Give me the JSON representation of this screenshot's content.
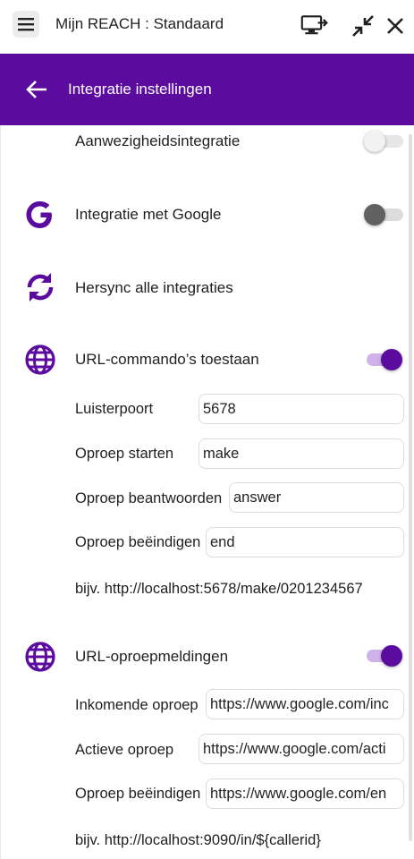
{
  "window": {
    "title": "Mijn REACH : Standaard",
    "icons": [
      "menu-icon",
      "screen-share-icon",
      "minimize-arrows-icon",
      "close-icon"
    ]
  },
  "header": {
    "title": "Integratie instellingen",
    "back_icon": "arrow-left-icon",
    "background": "#5b0c9e"
  },
  "settings": {
    "presence": {
      "label": "Aanwezigheidsintegratie",
      "enabled": false
    },
    "google": {
      "label": "Integratie met Google",
      "enabled": false,
      "icon": "google-g-icon"
    },
    "resync": {
      "label": "Hersync alle integraties",
      "icon": "sync-icon"
    },
    "url_commands": {
      "label": "URL-commando’s toestaan",
      "enabled": true,
      "icon": "globe-icon",
      "fields": {
        "port_label": "Luisterpoort",
        "port_value": "5678",
        "make_label": "Oproep starten",
        "make_value": "make",
        "answer_label": "Oproep beantwoorden",
        "answer_value": "answer",
        "end_label": "Oproep beëindigen",
        "end_value": "end"
      },
      "example": "bijv. http://localhost:5678/make/0201234567"
    },
    "url_notifications": {
      "label": "URL-oproepmeldingen",
      "enabled": true,
      "icon": "globe-icon",
      "fields": {
        "incoming_label": "Inkomende oproep",
        "incoming_value": "https://www.google.com/inc",
        "active_label": "Actieve oproep",
        "active_value": "https://www.google.com/acti",
        "end_label": "Oproep beëindigen",
        "end_value": "https://www.google.com/en"
      },
      "example": "bijv. http://localhost:9090/in/${callerid}"
    }
  },
  "colors": {
    "accent": "#5b0c9e",
    "accent_light": "#cfb2ea"
  }
}
